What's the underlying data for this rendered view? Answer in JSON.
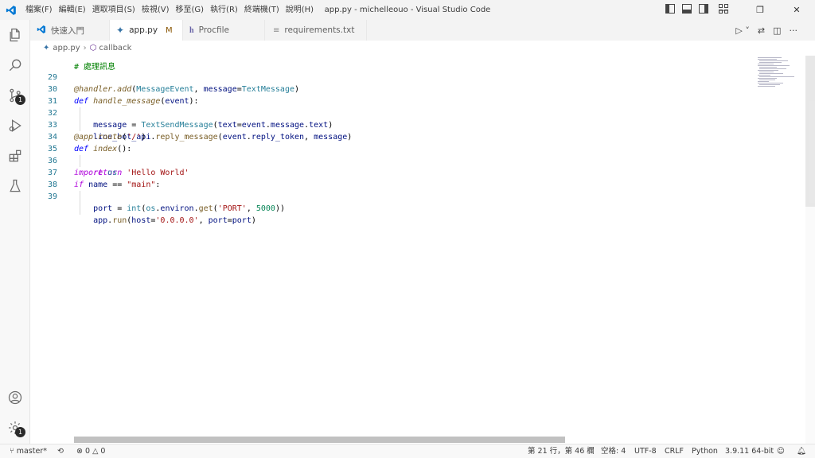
{
  "titlebar": {
    "menu": [
      "檔案(F)",
      "編輯(E)",
      "選取項目(S)",
      "檢視(V)",
      "移至(G)",
      "執行(R)",
      "終端機(T)",
      "說明(H)"
    ],
    "title": "app.py - michelleouo - Visual Studio Code",
    "minimize": "—",
    "restore": "❐",
    "close": "✕"
  },
  "activity": {
    "source_control_badge": "1",
    "settings_badge": "1"
  },
  "tabs": [
    {
      "label": "快速入門",
      "icon": "vscode-icon"
    },
    {
      "label": "app.py",
      "icon": "python-icon",
      "modified": "M"
    },
    {
      "label": "Procfile",
      "icon": "heroku-icon"
    },
    {
      "label": "requirements.txt",
      "icon": "text-file-icon"
    }
  ],
  "breadcrumb": {
    "file": "app.py",
    "sep": "›",
    "symbol": "callback"
  },
  "editor": {
    "partial_line": "# 處理訊息",
    "line_numbers": [
      "29",
      "30",
      "31",
      "32",
      "33",
      "34",
      "35",
      "36",
      "37",
      "38",
      "39"
    ]
  },
  "statusbar": {
    "branch": "master*",
    "errors": "0",
    "warnings": "0",
    "position": "第 21 行，第 46 欄",
    "spaces": "空格: 4",
    "encoding": "UTF-8",
    "eol": "CRLF",
    "language": "Python",
    "interpreter": "3.9.11 64-bit"
  },
  "colors": {
    "accent": "#007acc",
    "keyword": "#af00db",
    "string": "#a31515",
    "number": "#098658",
    "type": "#267f99",
    "function": "#795e26"
  }
}
